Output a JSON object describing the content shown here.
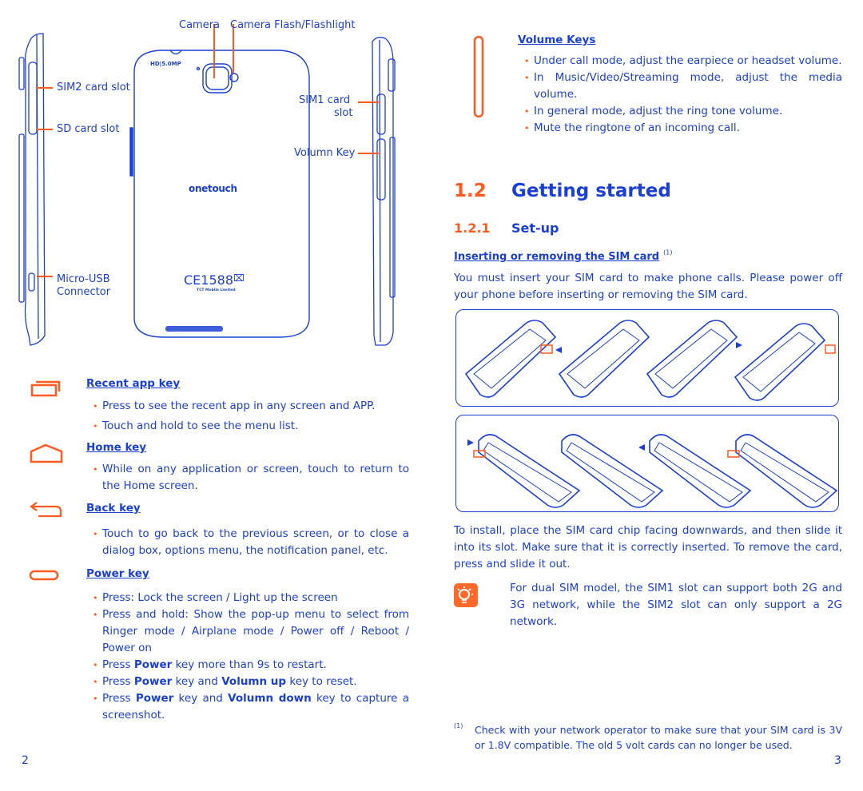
{
  "colors": {
    "text": "#1a3fd6",
    "accent": "#ff5a1f",
    "white": "#ffffff"
  },
  "diagram": {
    "labels": {
      "camera": "Camera",
      "flash": "Camera Flash/Flashlight",
      "sim2": "SIM2 card slot",
      "sd": "SD card slot",
      "sim1_line1": "SIM1  card",
      "sim1_line2": "slot",
      "volume": "Volumn Key",
      "usb_line1": "Micro-USB",
      "usb_line2": "Connector"
    },
    "phone_markings": {
      "hd": "HD|5.0MP",
      "brand": "onetouch",
      "ce": "CE1588",
      "maker": "TCT Mobile Limited"
    }
  },
  "left_page": {
    "page_number": "2",
    "keys": [
      {
        "icon": "recent-apps-icon",
        "title": "Recent app key",
        "bullets": [
          "Press to see the recent app in any screen and APP.",
          "Touch and hold to see the menu list."
        ]
      },
      {
        "icon": "home-icon",
        "title": "Home key",
        "bullets": [
          "While on any application or screen, touch to return to the Home screen."
        ]
      },
      {
        "icon": "back-icon",
        "title": "Back key",
        "bullets": [
          "Touch to go back to the previous screen, or to close a dialog box, options menu, the notification panel, etc."
        ]
      },
      {
        "icon": "power-key-icon",
        "title": "Power key",
        "bullets": [
          "Press: Lock the screen / Light up the screen",
          "Press and hold: Show the pop-up menu to select from Ringer mode / Airplane mode / Power off / Reboot / Power on"
        ],
        "rich_bullets": [
          {
            "a": "Press ",
            "b1": "Power",
            "c": " key more than 9s to restart.",
            "b2": "",
            "d": ""
          },
          {
            "a": "Press ",
            "b1": "Power",
            "c": " key and ",
            "b2": "Volumn up",
            "d": " key to reset."
          },
          {
            "a": "Press ",
            "b1": "Power",
            "c": " key and ",
            "b2": "Volumn down",
            "d": " key to capture a screenshot."
          }
        ]
      }
    ]
  },
  "right_page": {
    "page_number": "3",
    "volume_keys": {
      "title": "Volume Keys",
      "bullets": [
        "Under call mode, adjust the earpiece or headset volume.",
        "In Music/Video/Streaming mode, adjust the media volume.",
        "In general mode, adjust the ring tone volume.",
        "Mute the ringtone of an incoming call."
      ]
    },
    "section": {
      "number": "1.2",
      "title": "Getting started"
    },
    "subsection": {
      "number": "1.2.1",
      "title": "Set-up"
    },
    "sim_heading": "Inserting or removing the SIM card",
    "sim_heading_note": "(1)",
    "intro": "You must insert your SIM card to make phone calls. Please power off your phone before inserting or removing the SIM card.",
    "install_text": "To install, place the SIM card chip facing downwards, and then slide it into its slot. Make sure that it is correctly inserted. To remove the card, press and slide it out.",
    "tip_text": "For dual SIM model, the SIM1 slot can support both 2G and 3G network, while the SIM2 slot can only support a 2G network.",
    "footnote_marker": "(1)",
    "footnote": "Check with your network operator to make sure that your SIM card is 3V or 1.8V compatible. The old 5 volt cards can no longer be used."
  }
}
